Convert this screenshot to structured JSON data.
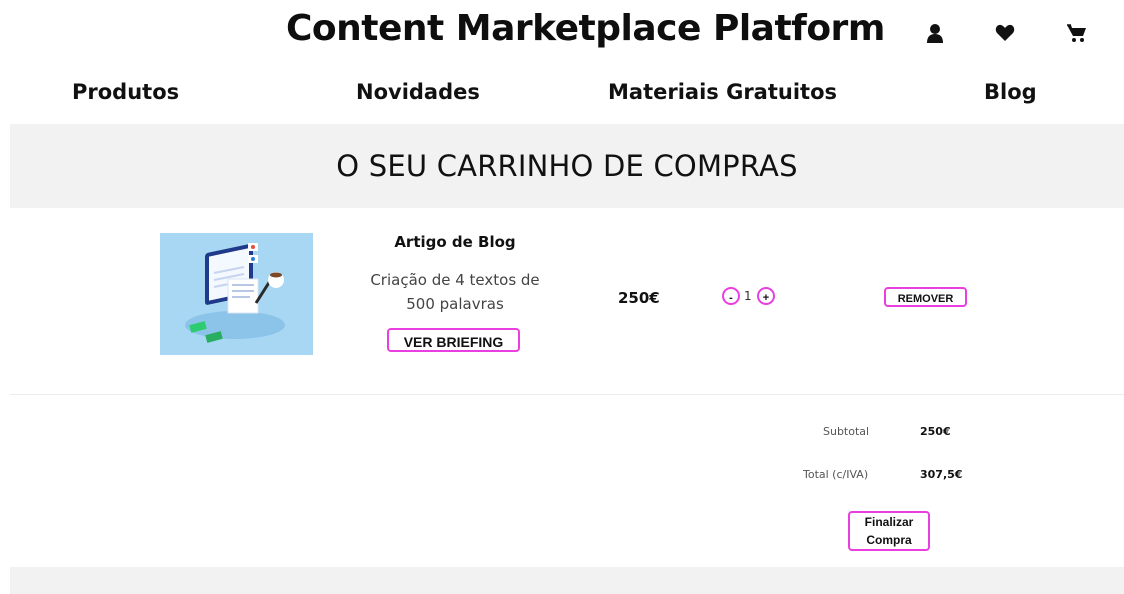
{
  "header": {
    "title": "Content Marketplace Platform",
    "icons": [
      "user-icon",
      "heart-icon",
      "cart-icon"
    ]
  },
  "nav": {
    "items": [
      {
        "label": "Produtos"
      },
      {
        "label": "Novidades"
      },
      {
        "label": "Materiais Gratuitos"
      },
      {
        "label": "Blog"
      }
    ]
  },
  "banner": {
    "title": "O SEU CARRINHO DE COMPRAS"
  },
  "cart": {
    "items": [
      {
        "name": "Artigo de Blog",
        "description": "Criação de 4 textos de 500 palavras",
        "briefing_label": "VER BRIEFING",
        "price": "250€",
        "quantity": "1",
        "minus_label": "-",
        "plus_label": "+",
        "remove_label": "REMOVER"
      }
    ]
  },
  "summary": {
    "subtotal_label": "Subtotal",
    "subtotal_value": "250€",
    "total_label": "Total (c/IVA)",
    "total_value": "307,5€",
    "checkout_label": "Finalizar Compra"
  },
  "colors": {
    "accent": "#ea3fe0",
    "banner_bg": "#f2f2f2",
    "image_bg": "#a8d7f4"
  }
}
